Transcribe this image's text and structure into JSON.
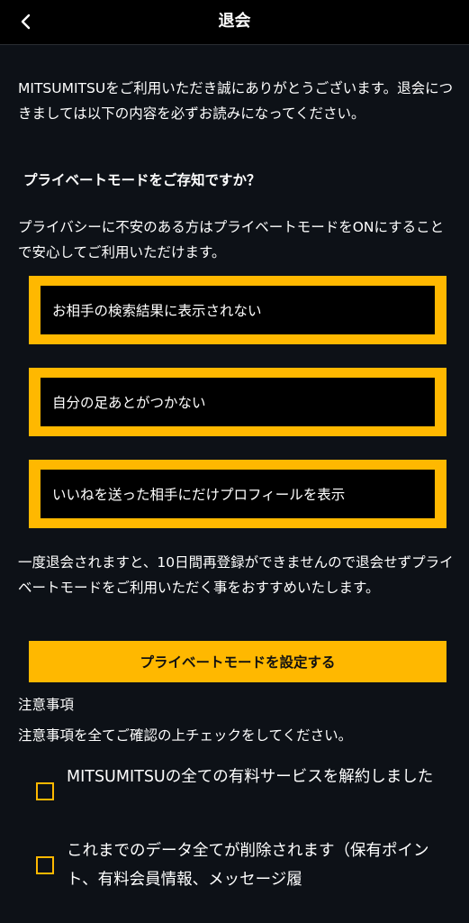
{
  "header": {
    "title": "退会",
    "back_icon": "chevron-left-icon"
  },
  "intro": {
    "text": "MITSUMITSUをご利用いただき誠にありがとうございます。退会につきましては以下の内容を必ずお読みになってください。"
  },
  "private_mode": {
    "heading": "プライベートモードをご存知ですか？",
    "description": "プライバシーに不安のある方はプライベートモードをONにすることで安心してご利用いただけます。",
    "features": [
      "お相手の検索結果に表示されない",
      "自分の足あとがつかない",
      "いいねを送った相手にだけプロフィールを表示"
    ],
    "note": "一度退会されますと、10日間再登録ができませんので退会せずプライベートモードをご利用いただく事をおすすめいたします。",
    "cta_label": "プライベートモードを設定する"
  },
  "notices": {
    "title": "注意事項",
    "instruction": "注意事項を全てご確認の上チェックをしてください。",
    "items": [
      "MITSUMITSUの全ての有料サービスを解約しました",
      "これまでのデータ全てが削除されます（保有ポイント、有料会員情報、メッセージ履"
    ]
  },
  "colors": {
    "accent": "#ffb800",
    "background": "#0d1117",
    "header_bg": "#000000"
  }
}
